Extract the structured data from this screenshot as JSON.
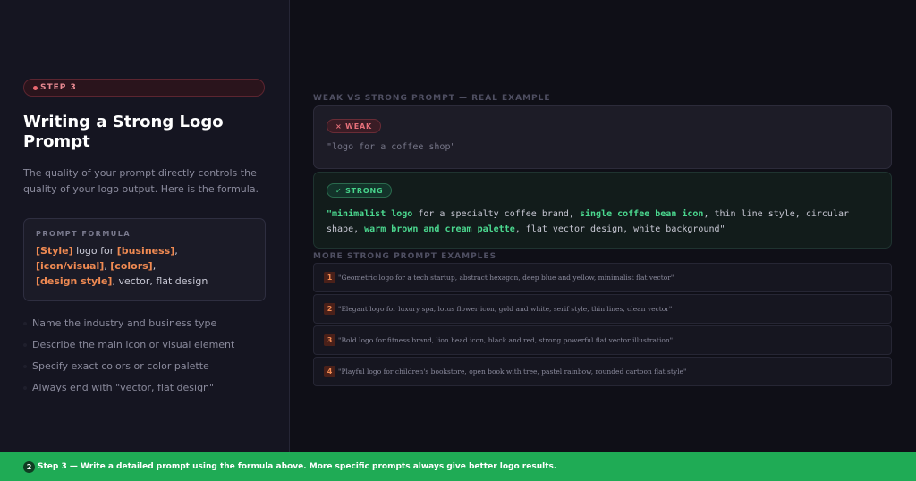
{
  "step": {
    "label": "STEP 3"
  },
  "title": "Writing a Strong Logo Prompt",
  "description": "The quality of your prompt directly controls the quality of your logo output. Here is the formula.",
  "formula": {
    "label": "PROMPT FORMULA",
    "line1": {
      "p1": "[Style]",
      "t1": " logo for ",
      "p2": "[business]",
      "t2": ","
    },
    "line2": {
      "p1": "[icon/visual]",
      "t1": ", ",
      "p2": "[colors]",
      "t2": ","
    },
    "line3": {
      "p1": "[design style]",
      "t1": ", vector, flat design"
    }
  },
  "tips": [
    "Name the industry and business type",
    "Describe the main icon or visual element",
    "Specify exact colors or color palette",
    "Always end with \"vector, flat design\""
  ],
  "comparison": {
    "label": "WEAK VS STRONG PROMPT — REAL EXAMPLE",
    "weak": {
      "badge": "× WEAK",
      "text": "\"logo for a coffee shop\""
    },
    "strong": {
      "badge": "✓ STRONG",
      "s1": "\"minimalist logo",
      "t1": " for a specialty coffee brand, ",
      "s2": "single coffee bean icon",
      "t2": ", thin line style, circular shape, ",
      "s3": "warm brown and cream palette",
      "t3": ", flat vector design, white background\""
    }
  },
  "examples": {
    "label": "MORE STRONG PROMPT EXAMPLES",
    "items": [
      {
        "num": "1",
        "text": "\"Geometric logo for a tech startup, abstract hexagon, deep blue and yellow, minimalist flat vector\""
      },
      {
        "num": "2",
        "text": "\"Elegant logo for luxury spa, lotus flower icon, gold and white, serif style, thin lines, clean vector\""
      },
      {
        "num": "3",
        "text": "\"Bold logo for fitness brand, lion head icon, black and red, strong powerful flat vector illustration\""
      },
      {
        "num": "4",
        "text": "\"Playful logo for children's bookstore, open book with tree, pastel rainbow, rounded cartoon flat style\""
      }
    ]
  },
  "footer": {
    "num": "2",
    "text": "Step 3 — Write a detailed prompt using the formula above. More specific prompts always give better logo results."
  },
  "colors": {
    "accent_orange": "#f08a52",
    "strong_green": "#4bd88f",
    "weak_red": "#e7707a",
    "footer_green": "#1fab55"
  }
}
